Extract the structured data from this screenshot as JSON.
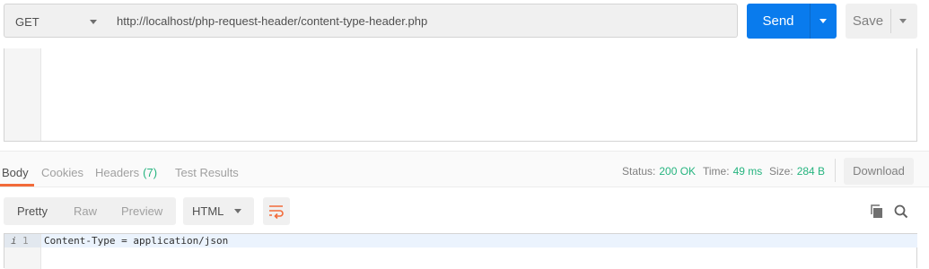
{
  "request": {
    "method": "GET",
    "url": "http://localhost/php-request-header/content-type-header.php",
    "send_label": "Send",
    "save_label": "Save"
  },
  "response_tabs": [
    {
      "label": "Body",
      "active": true
    },
    {
      "label": "Cookies"
    },
    {
      "label": "Headers",
      "badge": "(7)"
    },
    {
      "label": "Test Results"
    }
  ],
  "response_meta": {
    "status_label": "Status:",
    "status_value": "200 OK",
    "time_label": "Time:",
    "time_value": "49 ms",
    "size_label": "Size:",
    "size_value": "284 B",
    "download_label": "Download"
  },
  "format_toolbar": {
    "modes": [
      "Pretty",
      "Raw",
      "Preview"
    ],
    "active_mode": "Pretty",
    "language": "HTML",
    "icons": [
      "wrap-lines-icon",
      "copy-icon",
      "search-icon"
    ]
  },
  "response_body": {
    "line_info_marker": "i",
    "line_number": "1",
    "line_text": "Content-Type = application/json"
  },
  "colors": {
    "send_button": "#097bed",
    "active_tab_underline": "#f26b3a",
    "status_value": "#26b47f",
    "wrap_icon": "#f26b3a"
  }
}
